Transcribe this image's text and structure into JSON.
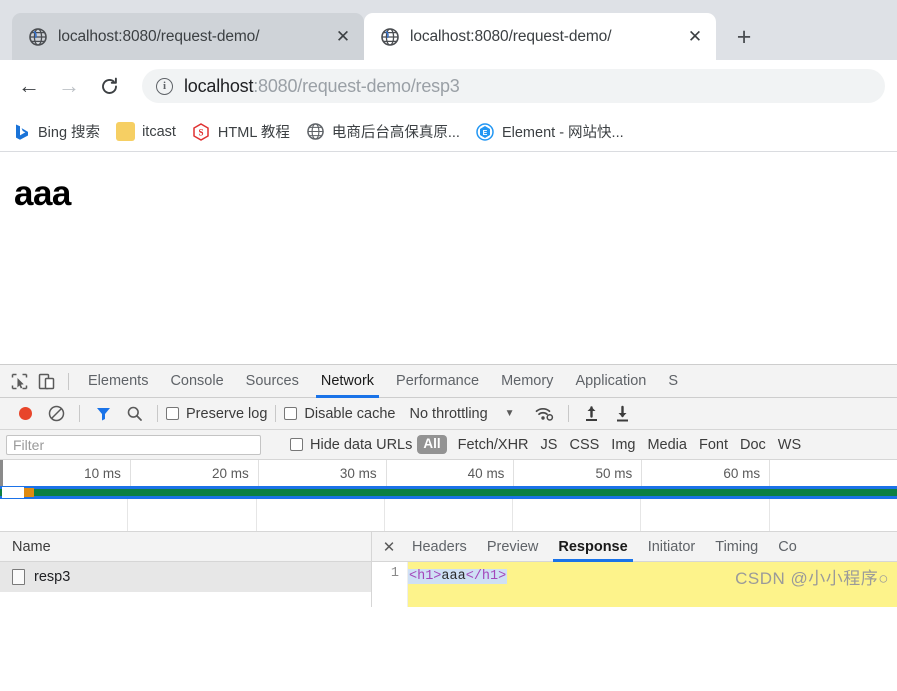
{
  "browser": {
    "tabs": [
      {
        "title": "localhost:8080/request-demo/",
        "favicon": "globe-icon",
        "close": "✕",
        "active": false
      },
      {
        "title": "localhost:8080/request-demo/",
        "favicon": "globe-icon",
        "close": "✕",
        "active": true
      }
    ],
    "new_tab_label": "+",
    "nav": {
      "back": "←",
      "forward": "→",
      "reload": "⟳"
    },
    "omnibox": {
      "info_glyph": "i",
      "url_host": "localhost",
      "url_rest": ":8080/request-demo/resp3",
      "full_url": "localhost:8080/request-demo/resp3"
    },
    "bookmarks": [
      {
        "label": "Bing 搜索",
        "icon": "bing-icon",
        "glyph": "b",
        "color": "#1a6fe0",
        "bg": "transparent"
      },
      {
        "label": "itcast",
        "icon": "folder-icon",
        "glyph": "",
        "color": "#f5c242",
        "bg": "#f6cf63"
      },
      {
        "label": "HTML 教程",
        "icon": "runoob-icon",
        "glyph": "S",
        "color": "#e03131",
        "bg": "transparent"
      },
      {
        "label": "电商后台高保真原...",
        "icon": "globe-icon",
        "glyph": "",
        "color": "#5f6368",
        "bg": "transparent"
      },
      {
        "label": "Element - 网站快...",
        "icon": "element-icon",
        "glyph": "E",
        "color": "#2196f3",
        "bg": "transparent"
      }
    ]
  },
  "page": {
    "heading": "aaa"
  },
  "devtools": {
    "inspect_icon": "cursor-select-icon",
    "device_icon": "device-toolbar-icon",
    "tabs": [
      {
        "label": "Elements",
        "active": false
      },
      {
        "label": "Console",
        "active": false
      },
      {
        "label": "Sources",
        "active": false
      },
      {
        "label": "Network",
        "active": true
      },
      {
        "label": "Performance",
        "active": false
      },
      {
        "label": "Memory",
        "active": false
      },
      {
        "label": "Application",
        "active": false
      },
      {
        "label": "S",
        "active": false
      }
    ],
    "toolbar": {
      "record_icon": "record-dot-icon",
      "clear_icon": "clear-no-entry-icon",
      "filter_icon": "funnel-icon",
      "search_icon": "magnifier-icon",
      "preserve_log": "Preserve log",
      "disable_cache": "Disable cache",
      "throttling": "No throttling",
      "caret": "▼",
      "wifi_icon": "network-conditions-icon",
      "import_icon": "upload-arrow-icon",
      "export_icon": "download-arrow-icon"
    },
    "filterbar": {
      "filter_placeholder": "Filter",
      "hide_data_urls": "Hide data URLs",
      "selected_type": "All",
      "types": [
        "Fetch/XHR",
        "JS",
        "CSS",
        "Img",
        "Media",
        "Font",
        "Doc",
        "WS"
      ]
    },
    "overview": {
      "ticks": [
        "10 ms",
        "20 ms",
        "30 ms",
        "40 ms",
        "50 ms",
        "60 ms",
        ""
      ],
      "bar_colors": {
        "blue": "#1b72e8",
        "green": "#0c8043",
        "orange": "#e08b12"
      }
    },
    "requests": {
      "column_header": "Name",
      "rows": [
        {
          "name": "resp3",
          "icon": "document-icon",
          "selected": true
        }
      ]
    },
    "detail": {
      "close": "✕",
      "tabs": [
        {
          "label": "Headers",
          "active": false
        },
        {
          "label": "Preview",
          "active": false
        },
        {
          "label": "Response",
          "active": true
        },
        {
          "label": "Initiator",
          "active": false
        },
        {
          "label": "Timing",
          "active": false
        },
        {
          "label": "Co",
          "active": false
        }
      ],
      "response": {
        "line_number": "1",
        "open_tag": "<h1>",
        "text": "aaa",
        "close_tag": "</h1>",
        "highlight_color": "#fdf38b"
      }
    }
  },
  "watermark": "CSDN @小小程序○"
}
